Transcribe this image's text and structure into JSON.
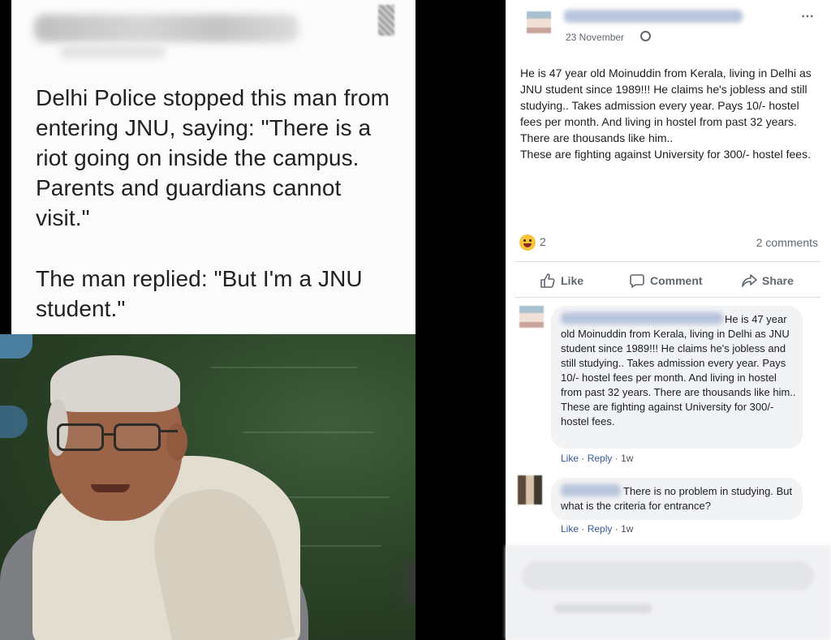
{
  "left_post": {
    "quote_line1": "Delhi Police stopped this man from entering JNU, saying: \"There is a riot going on inside the campus. Parents and guardians cannot visit.\"",
    "quote_line2": "The man replied: \"But I'm a JNU student.\""
  },
  "post": {
    "time": "23 November",
    "privacy_icon": "globe-icon",
    "more_icon": "⋯",
    "text": "He is 47 year old Moinuddin from Kerala, living in Delhi as JNU student since 1989!!! He claims he's jobless and still studying.. Takes admission every year. Pays 10/- hostel fees per month. And living in hostel from past 32 years. There are thousands like him..\nThese are fighting against University for 300/- hostel fees.",
    "reaction_count": "2",
    "comments_count": "2 comments"
  },
  "actions": {
    "like": "Like",
    "comment": "Comment",
    "share": "Share"
  },
  "comments": [
    {
      "text": "He is 47 year old Moinuddin from Kerala, living in Delhi as JNU student since 1989!!! He claims he's jobless and still studying.. Takes admission every year. Pays 10/- hostel fees per month. And living in hostel from past 32 years. There are thousands like him.. These are fighting against University for 300/- hostel fees.",
      "like": "Like",
      "reply": "Reply",
      "age": "1w"
    },
    {
      "text": "There is no problem in studying. But what is the criteria for entrance?",
      "like": "Like",
      "reply": "Reply",
      "age": "1w"
    }
  ],
  "colors": {
    "link": "#385898",
    "secondary_text": "#606770",
    "bubble": "#f2f3f5",
    "reaction_haha": "#f7c33a"
  }
}
